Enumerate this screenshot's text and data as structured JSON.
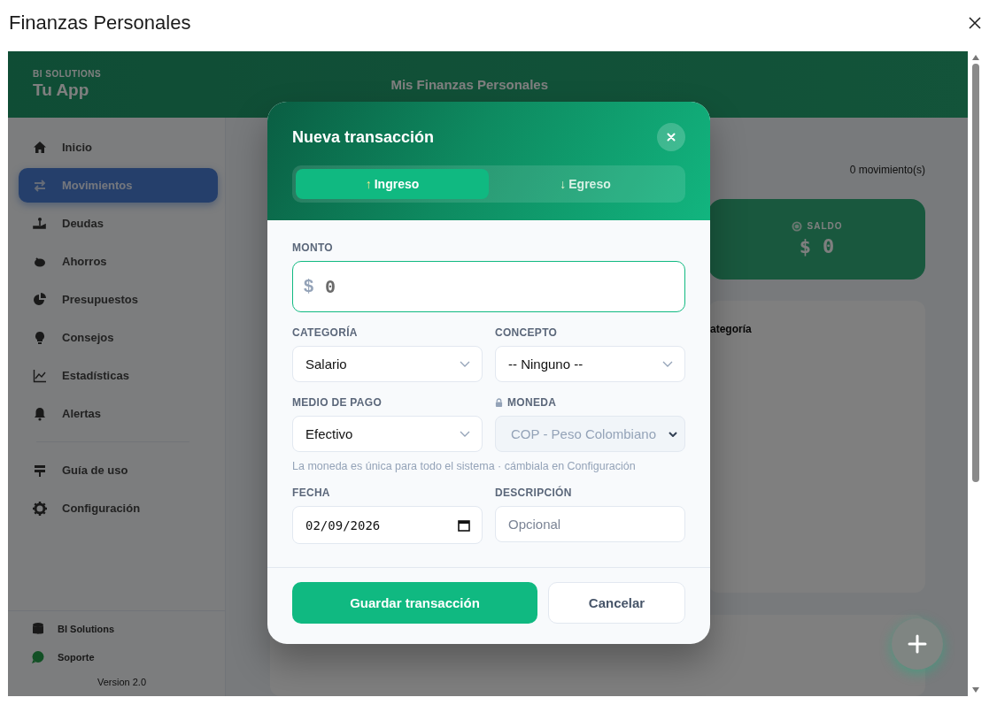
{
  "window": {
    "title": "Finanzas Personales"
  },
  "app": {
    "brand_small": "BI SOLUTIONS",
    "brand": "Tu App",
    "header_title": "Mis Finanzas Personales"
  },
  "sidebar": {
    "items": [
      {
        "label": "Inicio",
        "selected": false
      },
      {
        "label": "Movimientos",
        "selected": true
      },
      {
        "label": "Deudas",
        "selected": false
      },
      {
        "label": "Ahorros",
        "selected": false
      },
      {
        "label": "Presupuestos",
        "selected": false
      },
      {
        "label": "Consejos",
        "selected": false
      },
      {
        "label": "Estadísticas",
        "selected": false
      },
      {
        "label": "Alertas",
        "selected": false
      }
    ],
    "extra_items": [
      {
        "label": "Guía de uso",
        "selected": false
      },
      {
        "label": "Configuración",
        "selected": false
      }
    ],
    "footer_links": [
      "BI Solutions",
      "Soporte"
    ],
    "version": "Version 2.0"
  },
  "main": {
    "count": "0 movimiento(s)",
    "balance": {
      "label": "SALDO",
      "value": "$ 0"
    },
    "chart_card": {
      "title": "ategoría"
    }
  },
  "modal": {
    "title": "Nueva transacción",
    "tabs": [
      {
        "arrow": "↑",
        "label": "Ingreso",
        "selected": true
      },
      {
        "arrow": "↓",
        "label": "Egreso",
        "selected": false
      }
    ],
    "amount": {
      "label": "MONTO",
      "currency_symbol": "$",
      "placeholder": "0"
    },
    "fields": [
      {
        "kind": "select",
        "label": "CATEGORÍA",
        "value": "Salario",
        "disabled": false,
        "locked": false
      },
      {
        "kind": "select",
        "label": "CONCEPTO",
        "value": "-- Ninguno --",
        "disabled": false,
        "locked": false
      },
      {
        "kind": "select",
        "label": "MEDIO DE PAGO",
        "value": "Efectivo",
        "disabled": false,
        "locked": false
      },
      {
        "kind": "select",
        "label": "MONEDA",
        "value": "COP - Peso Colombiano",
        "disabled": true,
        "locked": true
      },
      {
        "kind": "note",
        "text": "La moneda es única para todo el sistema · cámbiala en Configuración"
      },
      {
        "kind": "date",
        "label": "FECHA",
        "value": "02/09/2026",
        "disabled": false,
        "locked": false
      },
      {
        "kind": "text",
        "label": "DESCRIPCIÓN",
        "placeholder": "Opcional",
        "disabled": false,
        "locked": false
      }
    ],
    "buttons": [
      {
        "kind": "primary",
        "label": "Guardar transacción"
      },
      {
        "kind": "secondary",
        "label": "Cancelar"
      }
    ]
  }
}
